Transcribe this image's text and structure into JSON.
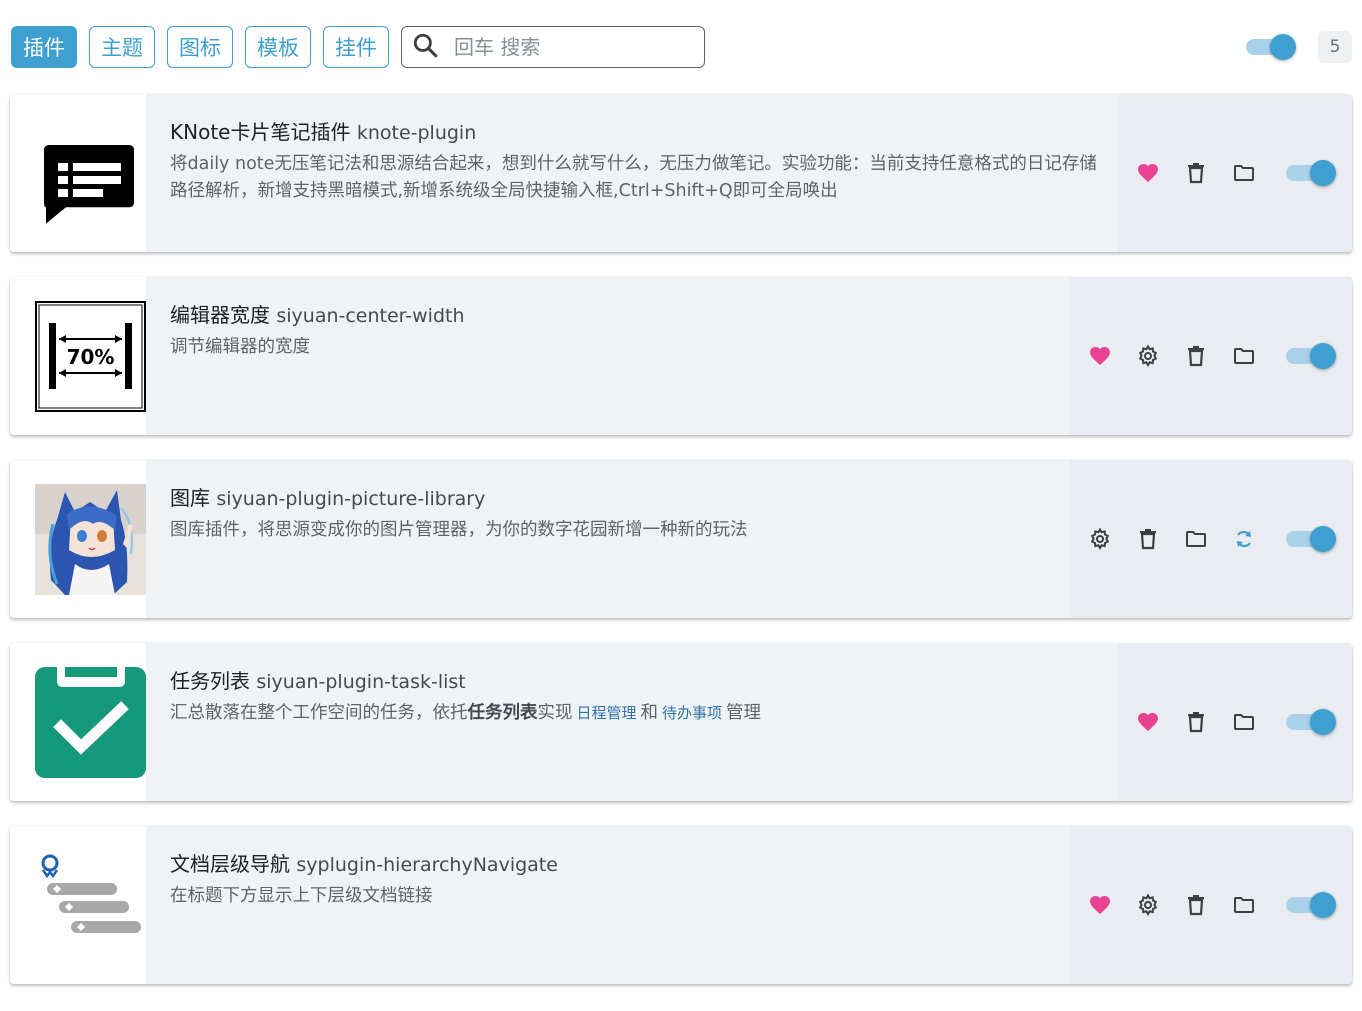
{
  "tabs": [
    {
      "label": "插件",
      "active": true
    },
    {
      "label": "主题",
      "active": false
    },
    {
      "label": "图标",
      "active": false
    },
    {
      "label": "模板",
      "active": false
    },
    {
      "label": "挂件",
      "active": false
    }
  ],
  "search": {
    "placeholder": "回车 搜索",
    "value": ""
  },
  "global_toggle": {
    "enabled": true
  },
  "count": "5",
  "colors": {
    "accent": "#3f9fd0",
    "heart": "#e84393",
    "card_bg": "#f0f3f6"
  },
  "plugins": [
    {
      "name": "KNote卡片笔记插件",
      "package": "knote-plugin",
      "description": "将daily note无压笔记法和思源结合起来，想到什么就写什么，无压力做笔记。实验功能：当前支持任意格式的日记存储路径解析，新增支持黑暗模式,新增系统级全局快捷输入框,Ctrl+Shift+Q即可全局唤出",
      "icon": "chat-list-icon",
      "actions": [
        "heart-icon",
        "trash-icon",
        "folder-icon"
      ],
      "enabled": true
    },
    {
      "name": "编辑器宽度",
      "package": "siyuan-center-width",
      "description": "调节编辑器的宽度",
      "icon": "width-70-icon",
      "icon_text": "70%",
      "actions": [
        "heart-icon",
        "gear-icon",
        "trash-icon",
        "folder-icon"
      ],
      "enabled": true
    },
    {
      "name": "图库",
      "package": "siyuan-plugin-picture-library",
      "description": "图库插件，将思源变成你的图片管理器，为你的数字花园新增一种新的玩法",
      "icon": "anime-girl-icon",
      "actions": [
        "gear-icon",
        "trash-icon",
        "folder-icon",
        "update-icon"
      ],
      "enabled": true
    },
    {
      "name": "任务列表",
      "package": "siyuan-plugin-task-list",
      "description_parts": {
        "pre": "汇总散落在整个工作空间的任务，依托",
        "bold": "任务列表",
        "mid": "实现",
        "link1": "日程管理",
        "and": "和",
        "link2": "待办事项",
        "post": "管理"
      },
      "icon": "clipboard-check-icon",
      "actions": [
        "heart-icon",
        "trash-icon",
        "folder-icon"
      ],
      "enabled": true
    },
    {
      "name": "文档层级导航",
      "package": "syplugin-hierarchyNavigate",
      "description": "在标题下方显示上下层级文档链接",
      "icon": "hierarchy-icon",
      "actions": [
        "heart-icon",
        "gear-icon",
        "trash-icon",
        "folder-icon"
      ],
      "enabled": true
    }
  ]
}
